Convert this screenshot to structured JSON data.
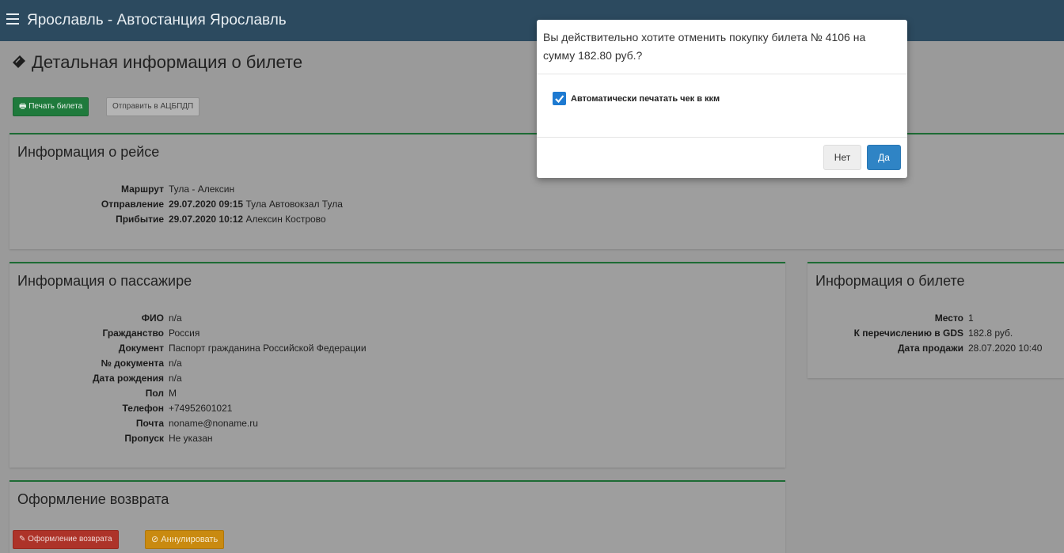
{
  "header": {
    "title": "Ярославль - Автостанция Ярославль"
  },
  "page": {
    "title": "Детальная информация о билете"
  },
  "toolbar": {
    "print_label": "Печать билета",
    "send_label": "Отправить в АЦБПДП"
  },
  "trip": {
    "title": "Информация о рейсе",
    "rows": [
      {
        "label": "Маршрут",
        "value": "Тула - Алексин"
      },
      {
        "label": "Отправление",
        "value_bold": "29.07.2020 09:15",
        "value": "Тула Автовокзал Тула"
      },
      {
        "label": "Прибытие",
        "value_bold": "29.07.2020 10:12",
        "value": "Алексин Кострово"
      }
    ]
  },
  "passenger": {
    "title": "Информация о пассажире",
    "rows": [
      {
        "label": "ФИО",
        "value": "n/a"
      },
      {
        "label": "Гражданство",
        "value": "Россия"
      },
      {
        "label": "Документ",
        "value": "Паспорт гражданина Российской Федерации"
      },
      {
        "label": "№ документа",
        "value": "n/a"
      },
      {
        "label": "Дата рождения",
        "value": "n/a"
      },
      {
        "label": "Пол",
        "value": "М"
      },
      {
        "label": "Телефон",
        "value": "+74952601021"
      },
      {
        "label": "Почта",
        "value": "noname@noname.ru"
      },
      {
        "label": "Пропуск",
        "value": "Не указан"
      }
    ]
  },
  "ticket": {
    "title": "Информация о билете",
    "rows": [
      {
        "label": "Место",
        "value": "1"
      },
      {
        "label": "К перечислению в GDS",
        "value": "182.8 руб."
      },
      {
        "label": "Дата продажи",
        "value": "28.07.2020 10:40"
      }
    ]
  },
  "refund": {
    "title": "Оформление возврата",
    "refund_label": "Оформление возврата",
    "cancel_label": "Аннулировать"
  },
  "modal": {
    "message": "Вы действительно хотите отменить покупку билета № 4106 на сумму 182.80 руб.?",
    "checkbox_label": "Автоматически печатать чек в ккм",
    "checkbox_checked": true,
    "no_label": "Нет",
    "yes_label": "Да"
  },
  "colors": {
    "topbar": "#2c4a5f",
    "accent_green": "#1d6b34",
    "primary_blue": "#2f84c5",
    "danger": "#ad3329",
    "warning": "#c98a10"
  },
  "icons": {
    "menu": "hamburger-icon",
    "ticket": "ticket-icon",
    "print": "print-icon",
    "edit": "edit-icon",
    "ban": "ban-icon",
    "check": "check-icon"
  }
}
